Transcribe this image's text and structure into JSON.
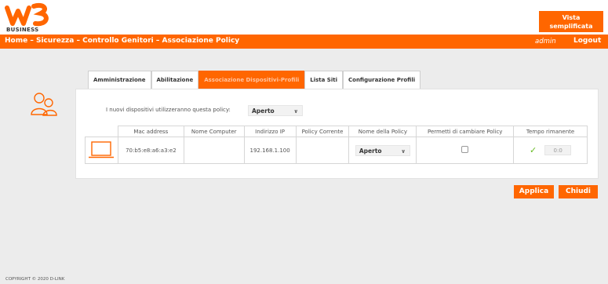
{
  "brand": {
    "logo_text": "w3",
    "sub": "BUSINESS",
    "accent": "#ff6600"
  },
  "header": {
    "vista_line1": "Vista",
    "vista_line2": "semplificata"
  },
  "nav": {
    "breadcrumb": "Home – Sicurezza – Controllo Genitori – Associazione Policy",
    "user": "admin",
    "logout": "Logout"
  },
  "tabs": [
    {
      "label": "Amministrazione",
      "active": false
    },
    {
      "label": "Abilitazione",
      "active": false
    },
    {
      "label": "Associazione Dispositivi-Profili",
      "active": true
    },
    {
      "label": "Lista Siti",
      "active": false
    },
    {
      "label": "Configurazione Profili",
      "active": false
    }
  ],
  "policy": {
    "label": "I nuovi dispositivi utilizzeranno questa policy:",
    "value": "Aperto"
  },
  "table": {
    "headers": [
      "",
      "Mac address",
      "Nome Computer",
      "Indirizzo IP",
      "Policy Corrente",
      "Nome della Policy",
      "Permetti di cambiare Policy",
      "Tempo rimanente"
    ],
    "rows": [
      {
        "icon": "laptop-icon",
        "mac": "70:b5:e8:a6:a3:e2",
        "computer": "",
        "ip": "192.168.1.100",
        "current_policy": "",
        "policy_name": "Aperto",
        "allow_change": false,
        "time": "0:0"
      }
    ]
  },
  "buttons": {
    "apply": "Applica",
    "close": "Chiudi"
  },
  "footer": {
    "copyright": "COPYRIGHT © 2020 D-LINK"
  }
}
